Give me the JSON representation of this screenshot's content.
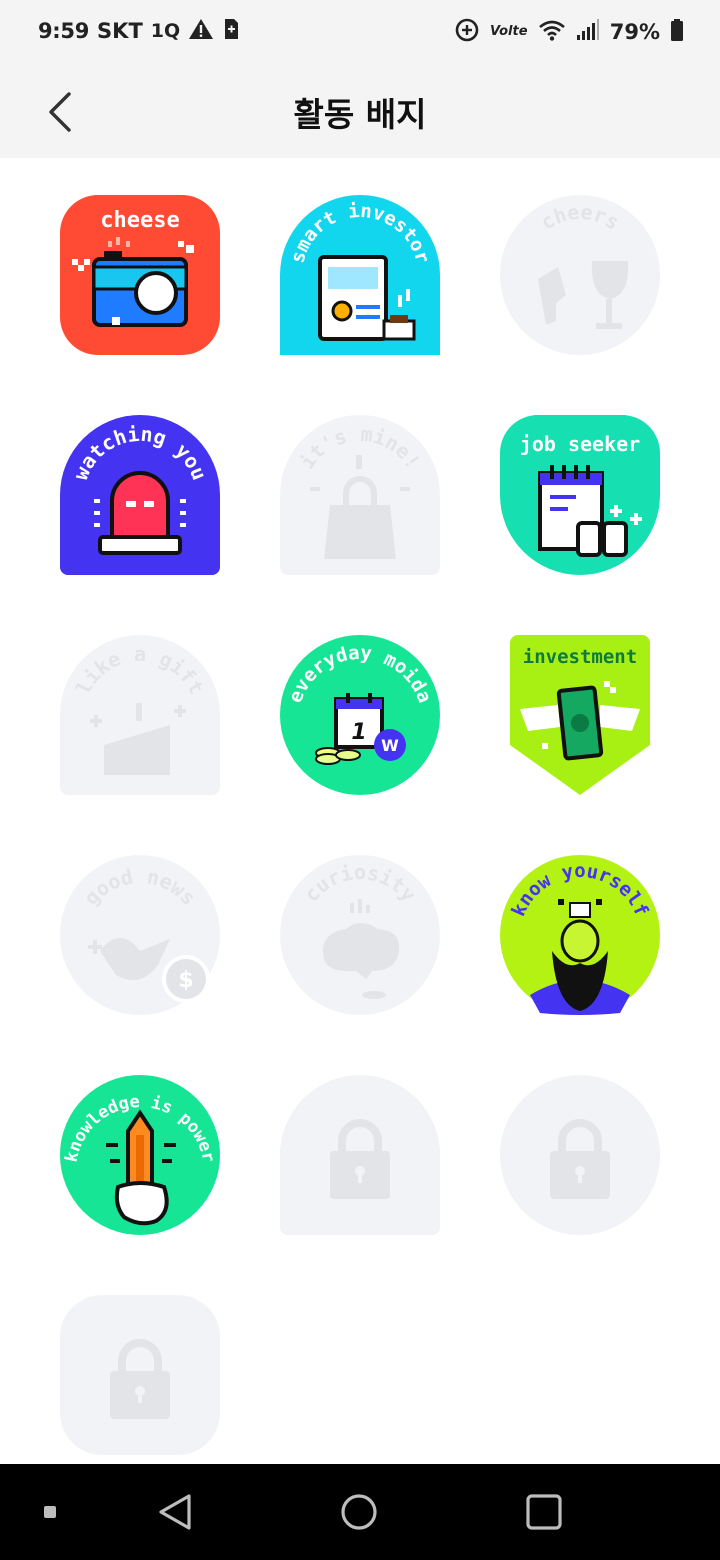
{
  "status_bar": {
    "time": "9:59",
    "carrier": "SKT",
    "network": "1Q",
    "battery_percent": "79%",
    "icons": [
      "warning-icon",
      "sim-icon",
      "data-saver-icon",
      "volte-icon",
      "wifi-icon",
      "signal-icon",
      "battery-icon"
    ]
  },
  "header": {
    "title": "활동 배지",
    "back_icon": "chevron-left-icon"
  },
  "badges": [
    {
      "label": "cheese",
      "earned": true,
      "color": "#FF4B33"
    },
    {
      "label": "smart investor",
      "earned": true,
      "color": "#12D5EE"
    },
    {
      "label": "cheers",
      "earned": false,
      "color": "#F2F3F6"
    },
    {
      "label": "watching you",
      "earned": true,
      "color": "#4433F0"
    },
    {
      "label": "it's mine!",
      "earned": false,
      "color": "#F2F3F6"
    },
    {
      "label": "job seeker",
      "earned": true,
      "color": "#16E0B2"
    },
    {
      "label": "like a gift",
      "earned": false,
      "color": "#F2F3F6"
    },
    {
      "label": "everyday moida",
      "earned": true,
      "color": "#16E596"
    },
    {
      "label": "investment",
      "earned": true,
      "color": "#A8F014"
    },
    {
      "label": "good news",
      "earned": false,
      "color": "#F2F3F6"
    },
    {
      "label": "curiosity",
      "earned": false,
      "color": "#F2F3F6"
    },
    {
      "label": "know yourself",
      "earned": true,
      "color": "#B4F214"
    },
    {
      "label": "knowledge is power",
      "earned": true,
      "color": "#16E596"
    },
    {
      "label": "",
      "earned": false,
      "locked": true
    },
    {
      "label": "",
      "earned": false,
      "locked": true
    },
    {
      "label": "",
      "earned": false,
      "locked": true
    }
  ],
  "nav_bar": {
    "buttons": [
      "recent-dot-icon",
      "back-triangle-icon",
      "home-circle-icon",
      "overview-square-icon"
    ]
  }
}
